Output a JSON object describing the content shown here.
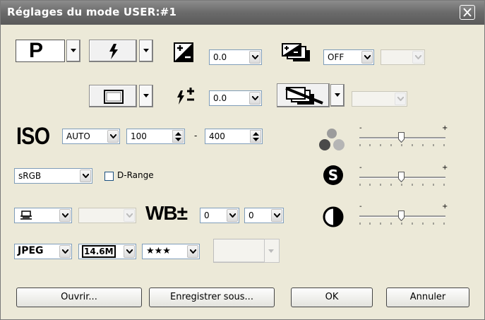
{
  "window": {
    "title": "Réglages du mode USER:#1"
  },
  "exposure_mode": {
    "value": "P"
  },
  "exposure_comp": {
    "value": "0.0"
  },
  "bracketing": {
    "value": "OFF"
  },
  "flash_comp": {
    "value": "0.0"
  },
  "iso": {
    "label": "ISO",
    "mode": "AUTO",
    "min": "100",
    "separator": "-",
    "max": "400"
  },
  "color_space": {
    "value": "sRGB"
  },
  "d_range": {
    "label": "D-Range"
  },
  "wb": {
    "label": "WB±",
    "value_a": "0",
    "value_b": "0"
  },
  "format": {
    "type": "JPEG",
    "size": "14.6M",
    "quality": "★★★"
  },
  "sliders": {
    "minus": "-",
    "plus": "+"
  },
  "buttons": {
    "open": "Ouvrir...",
    "save_as": "Enregistrer sous...",
    "ok": "OK",
    "cancel": "Annuler"
  }
}
